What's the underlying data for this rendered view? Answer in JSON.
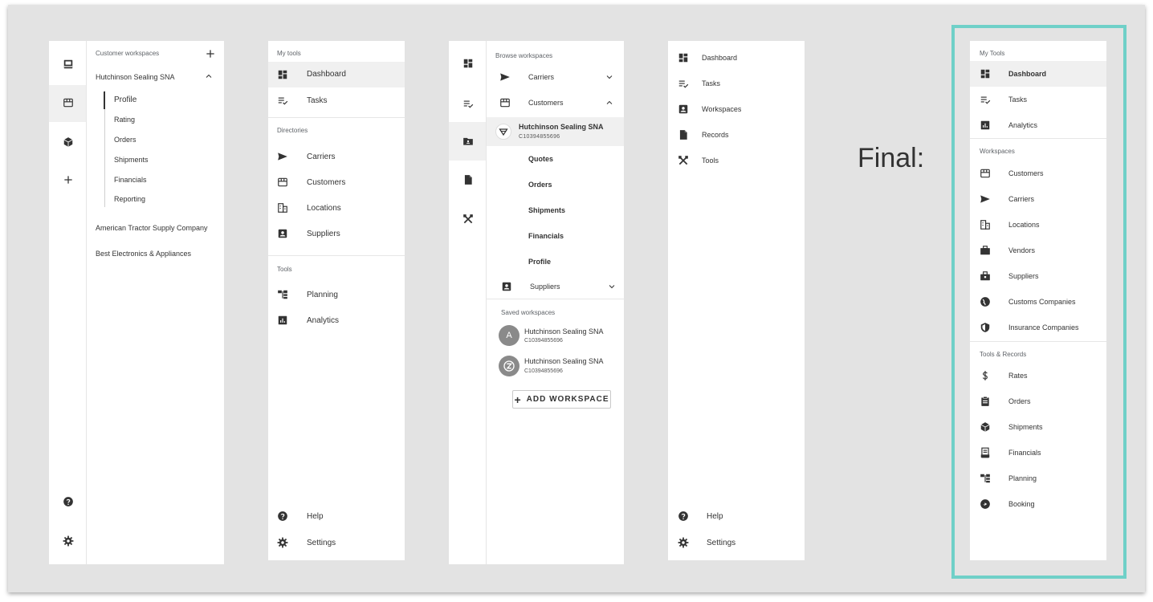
{
  "panel1": {
    "section_title": "Customer workspaces",
    "expanded_workspace": "Hutchinson Sealing SNA",
    "sub_items": [
      "Profile",
      "Rating",
      "Orders",
      "Shipments",
      "Financials",
      "Reporting"
    ],
    "other_workspaces": [
      "American Tractor Supply Company",
      "Best Electronics & Appliances"
    ]
  },
  "panel2": {
    "my_tools_title": "My tools",
    "my_tools": [
      "Dashboard",
      "Tasks"
    ],
    "directories_title": "Directories",
    "directories": [
      "Carriers",
      "Customers",
      "Locations",
      "Suppliers"
    ],
    "tools_title": "Tools",
    "tools": [
      "Planning",
      "Analytics"
    ],
    "footer": [
      "Help",
      "Settings"
    ]
  },
  "panel3": {
    "browse_title": "Browse workspaces",
    "carriers": "Carriers",
    "customers": "Customers",
    "customer_name": "Hutchinson Sealing SNA",
    "customer_id": "C10394855696",
    "sub_items": [
      "Quotes",
      "Orders",
      "Shipments",
      "Financials",
      "Profile"
    ],
    "suppliers": "Suppliers",
    "saved_title": "Saved workspaces",
    "saved": [
      {
        "initial": "A",
        "name": "Hutchinson Sealing SNA",
        "id": "C10394855696"
      },
      {
        "initial": "",
        "name": "Hutchinson Sealing SNA",
        "id": "C10394855696"
      }
    ],
    "add_button": "ADD WORKSPACE"
  },
  "panel4": {
    "items": [
      "Dashboard",
      "Tasks",
      "Workspaces",
      "Records",
      "Tools"
    ],
    "footer": [
      "Help",
      "Settings"
    ]
  },
  "final_label": "Final:",
  "panel5": {
    "my_tools_title": "My Tools",
    "my_tools": [
      {
        "label": "Dashboard",
        "icon": "dashboard-icon"
      },
      {
        "label": "Tasks",
        "icon": "tasks-icon"
      },
      {
        "label": "Analytics",
        "icon": "analytics-icon"
      }
    ],
    "workspaces_title": "Workspaces",
    "workspaces": [
      {
        "label": "Customers",
        "icon": "storefront-icon"
      },
      {
        "label": "Carriers",
        "icon": "send-icon"
      },
      {
        "label": "Locations",
        "icon": "building-icon"
      },
      {
        "label": "Vendors",
        "icon": "briefcase-icon"
      },
      {
        "label": "Suppliers",
        "icon": "toolbox-icon"
      },
      {
        "label": "Customs Companies",
        "icon": "globe-icon"
      },
      {
        "label": "Insurance Companies",
        "icon": "shield-icon"
      }
    ],
    "tools_title": "Tools & Records",
    "tools": [
      {
        "label": "Rates",
        "icon": "dollar-icon"
      },
      {
        "label": "Orders",
        "icon": "clipboard-icon"
      },
      {
        "label": "Shipments",
        "icon": "cube-icon"
      },
      {
        "label": "Financials",
        "icon": "receipt-icon"
      },
      {
        "label": "Planning",
        "icon": "planning-icon"
      },
      {
        "label": "Booking",
        "icon": "booking-icon"
      }
    ]
  },
  "colors": {
    "frame": "#6fd0c8",
    "background": "#e3e3e3",
    "highlight": "#f0f0f0",
    "icon": "#333333"
  }
}
